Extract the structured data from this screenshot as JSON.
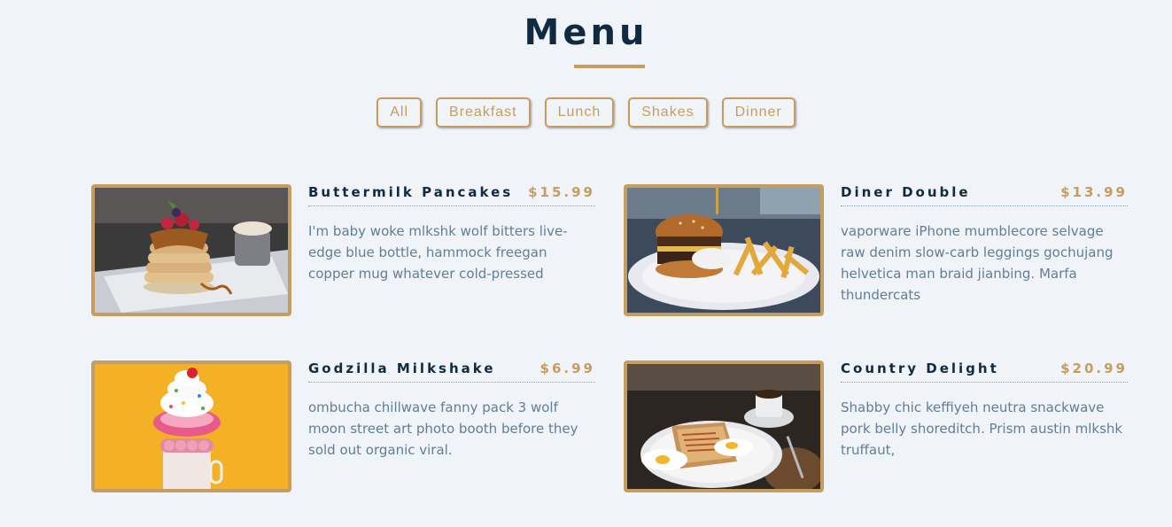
{
  "header": {
    "title": "Menu"
  },
  "filters": [
    "All",
    "Breakfast",
    "Lunch",
    "Shakes",
    "Dinner"
  ],
  "colors": {
    "accent": "#c59d5f",
    "title": "#102a42",
    "text": "#617d98",
    "background": "#f0f3f8"
  },
  "items": [
    {
      "name": "Buttermilk Pancakes",
      "price": "$15.99",
      "desc": "I'm baby woke mlkshk wolf bitters live-edge blue bottle, hammock freegan copper mug whatever cold-pressed",
      "image": "pancakes-photo"
    },
    {
      "name": "Diner Double",
      "price": "$13.99",
      "desc": "vaporware iPhone mumblecore selvage raw denim slow-carb leggings gochujang helvetica man braid jianbing. Marfa thundercats",
      "image": "burger-photo"
    },
    {
      "name": "Godzilla Milkshake",
      "price": "$6.99",
      "desc": "ombucha chillwave fanny pack 3 wolf moon street art photo booth before they sold out organic viral.",
      "image": "milkshake-photo"
    },
    {
      "name": "Country Delight",
      "price": "$20.99",
      "desc": "Shabby chic keffiyeh neutra snackwave pork belly shoreditch. Prism austin mlkshk truffaut,",
      "image": "breakfast-plate-photo"
    }
  ]
}
